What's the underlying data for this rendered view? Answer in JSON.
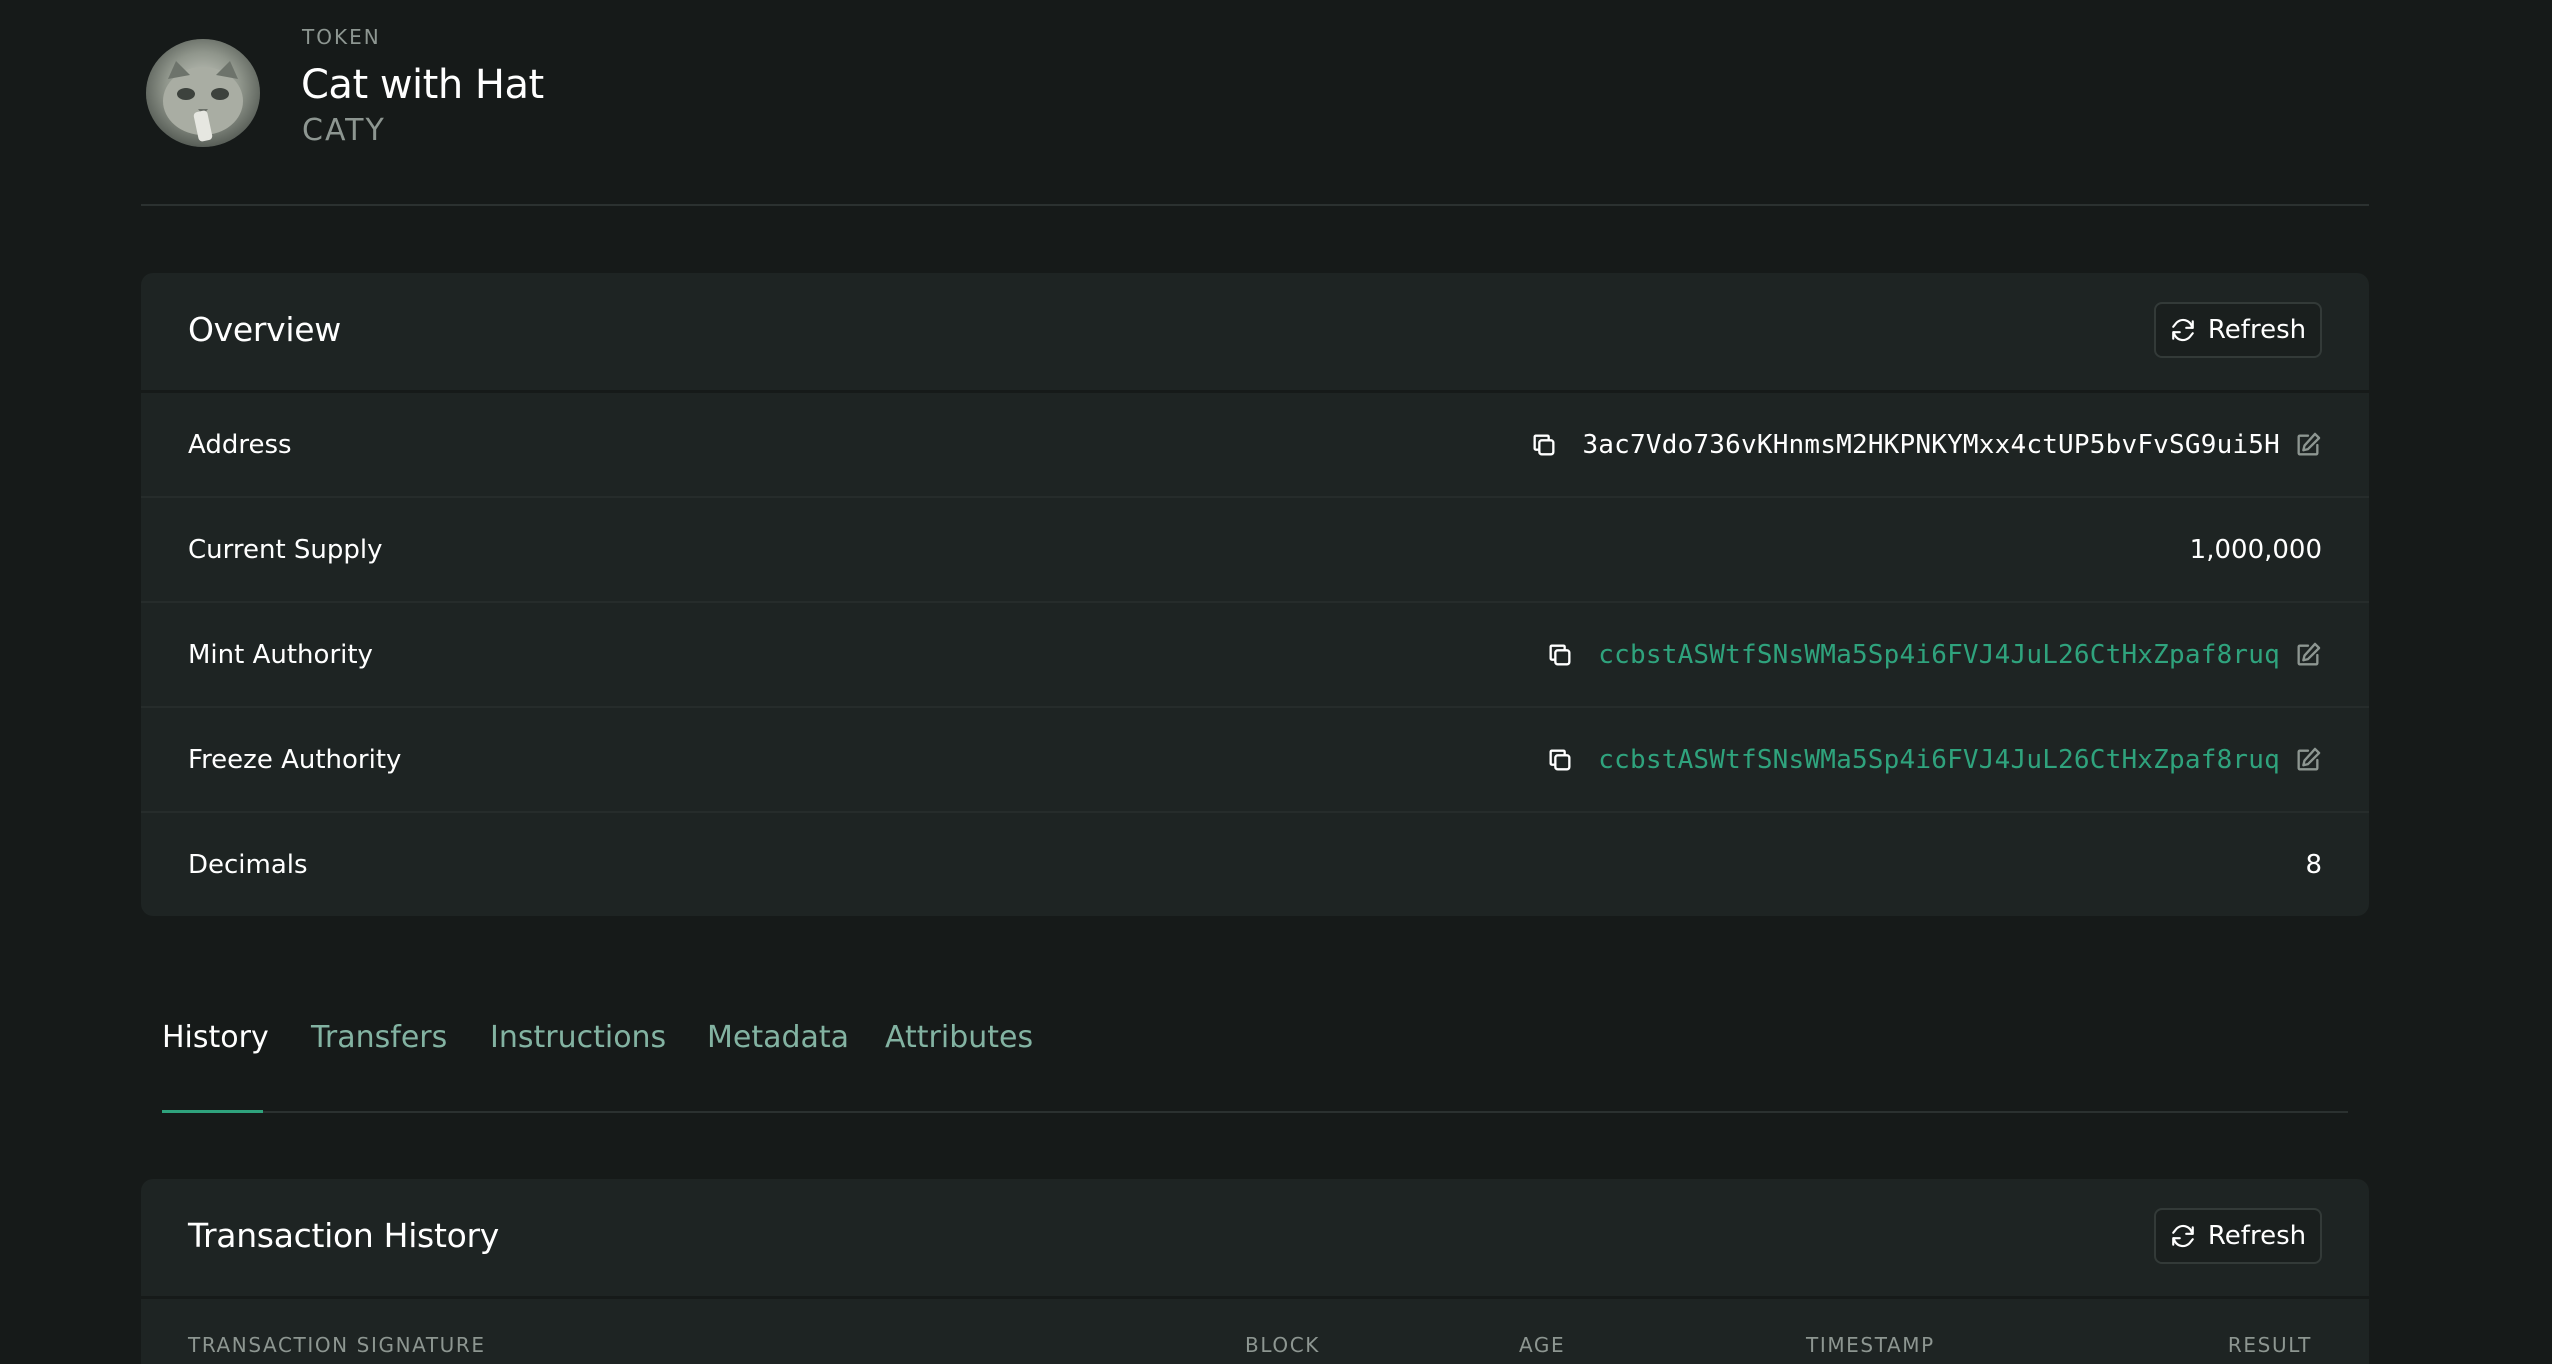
{
  "header": {
    "kind": "TOKEN",
    "name": "Cat with Hat",
    "symbol": "CATY"
  },
  "overview": {
    "title": "Overview",
    "refresh_label": "Refresh",
    "rows": [
      {
        "label": "Address",
        "value": "3ac7Vdo736vKHnmsM2HKPNKYMxx4ctUP5bvFvSG9ui5H"
      },
      {
        "label": "Current Supply",
        "value": "1,000,000"
      },
      {
        "label": "Mint Authority",
        "value": "ccbstASWtfSNsWMa5Sp4i6FVJ4JuL26CtHxZpaf8ruq"
      },
      {
        "label": "Freeze Authority",
        "value": "ccbstASWtfSNsWMa5Sp4i6FVJ4JuL26CtHxZpaf8ruq"
      },
      {
        "label": "Decimals",
        "value": "8"
      }
    ]
  },
  "tabs": [
    {
      "label": "History",
      "active": true
    },
    {
      "label": "Transfers"
    },
    {
      "label": "Instructions"
    },
    {
      "label": "Metadata"
    },
    {
      "label": "Attributes"
    }
  ],
  "history": {
    "title": "Transaction History",
    "refresh_label": "Refresh",
    "columns": [
      "TRANSACTION SIGNATURE",
      "BLOCK",
      "AGE",
      "TIMESTAMP",
      "RESULT"
    ]
  },
  "colors": {
    "background": "#161a19",
    "card": "#1e2423",
    "accent": "#2fa37d",
    "tab_inactive": "#83b3a2",
    "muted": "#8d9691"
  },
  "icons": {
    "refresh": "refresh-icon",
    "copy": "copy-icon",
    "edit": "edit-icon"
  }
}
